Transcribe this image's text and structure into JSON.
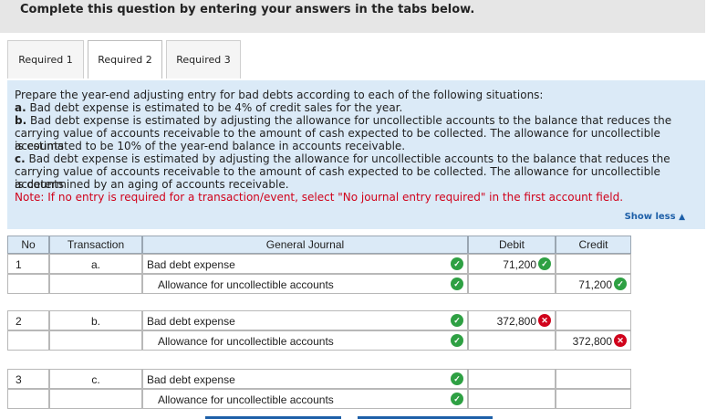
{
  "header": {
    "title": "Complete this question by entering your answers in the tabs below."
  },
  "tabs": [
    {
      "label": "Required 1"
    },
    {
      "label": "Required 2"
    },
    {
      "label": "Required 3"
    }
  ],
  "instructions": {
    "intro": "Prepare the year-end adjusting entry for bad debts according to each of the following situations:",
    "a_label": "a.",
    "a_text": " Bad debt expense is estimated to be 4% of credit sales for the year.",
    "b_label": "b.",
    "b_text_1": " Bad debt expense is estimated by adjusting the allowance for uncollectible accounts to the balance that reduces the",
    "b_text_2": "carrying value of accounts receivable to the amount of cash expected to be collected. The allowance for uncollectible accounts",
    "b_text_3": "is estimated to be 10% of the year-end balance in accounts receivable.",
    "c_label": "c.",
    "c_text_1": " Bad debt expense is estimated by adjusting the allowance for uncollectible accounts to the balance that reduces the",
    "c_text_2": "carrying value of accounts receivable to the amount of cash expected to be collected. The allowance for uncollectible accounts",
    "c_text_3": "is determined by an aging of accounts receivable.",
    "note": "Note: If no entry is required for a transaction/event, select \"No journal entry required\" in the first account field.",
    "show_less": "Show less"
  },
  "table": {
    "headers": {
      "no": "No",
      "transaction": "Transaction",
      "journal": "General Journal",
      "debit": "Debit",
      "credit": "Credit"
    },
    "rows": [
      {
        "no": "1",
        "transaction": "a.",
        "account": "Bad debt expense",
        "debit": "71,200",
        "credit": ""
      },
      {
        "no": "",
        "transaction": "",
        "account": "Allowance for uncollectible accounts",
        "debit": "",
        "credit": "71,200"
      },
      {
        "no": "2",
        "transaction": "b.",
        "account": "Bad debt expense",
        "debit": "372,800",
        "credit": ""
      },
      {
        "no": "",
        "transaction": "",
        "account": "Allowance for uncollectible accounts",
        "debit": "",
        "credit": "372,800"
      },
      {
        "no": "3",
        "transaction": "c.",
        "account": "Bad debt expense",
        "debit": "",
        "credit": ""
      },
      {
        "no": "",
        "transaction": "",
        "account": "Allowance for uncollectible accounts",
        "debit": "",
        "credit": ""
      }
    ]
  },
  "colors": {
    "correct": "#2ea043",
    "incorrect": "#d0021b",
    "panel": "#dbeaf7",
    "link": "#1d5fa8"
  }
}
